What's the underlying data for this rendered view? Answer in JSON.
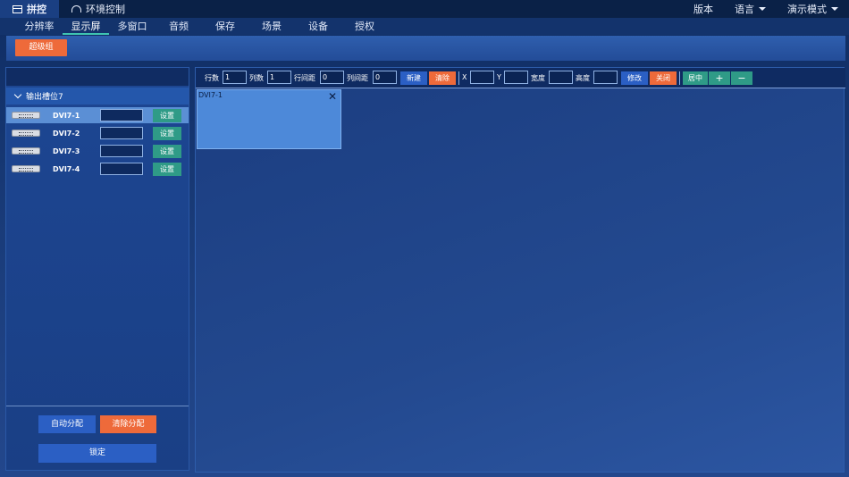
{
  "topbar": {
    "tabs": [
      {
        "label": "拼控",
        "icon": "layout-icon",
        "active": true
      },
      {
        "label": "环境控制",
        "icon": "gauge-icon",
        "active": false
      }
    ],
    "right_menu": [
      {
        "label": "版本",
        "dropdown": false
      },
      {
        "label": "语言",
        "dropdown": true
      },
      {
        "label": "演示模式",
        "dropdown": true
      }
    ]
  },
  "subnav": {
    "tabs": [
      "分辨率",
      "显示屏",
      "多窗口",
      "音频",
      "保存",
      "场景",
      "设备",
      "授权"
    ],
    "active_index": 1
  },
  "group": {
    "super_group_label": "超级组"
  },
  "output_slot": {
    "title": "输出槽位7",
    "ports": [
      {
        "name": "DVI7-1",
        "input_value": "",
        "set_label": "设置",
        "selected": true
      },
      {
        "name": "DVI7-2",
        "input_value": "",
        "set_label": "设置",
        "selected": false
      },
      {
        "name": "DVI7-3",
        "input_value": "",
        "set_label": "设置",
        "selected": false
      },
      {
        "name": "DVI7-4",
        "input_value": "",
        "set_label": "设置",
        "selected": false
      }
    ],
    "auto_assign_label": "自动分配",
    "clear_assign_label": "清除分配",
    "lock_label": "锁定"
  },
  "toolbar": {
    "rows_label": "行数",
    "rows_value": "1",
    "cols_label": "列数",
    "cols_value": "1",
    "row_gap_label": "行间距",
    "row_gap_value": "0",
    "col_gap_label": "列间距",
    "col_gap_value": "0",
    "new_label": "新建",
    "clear_label": "清除",
    "x_label": "X",
    "x_value": "",
    "y_label": "Y",
    "y_value": "",
    "width_label": "宽度",
    "width_value": "",
    "height_label": "高度",
    "height_value": "",
    "modify_label": "修改",
    "close_label": "关闭",
    "center_label": "居中",
    "plus_label": "+",
    "minus_label": "−"
  },
  "canvas": {
    "windows": [
      {
        "title": "DVI7-1",
        "close_symbol": "✕"
      }
    ]
  },
  "colors": {
    "accent_orange": "#ee6a3a",
    "accent_green": "#2f9b87",
    "accent_blue": "#2b5fc4",
    "active_tab_underline": "#3fc4b1"
  }
}
